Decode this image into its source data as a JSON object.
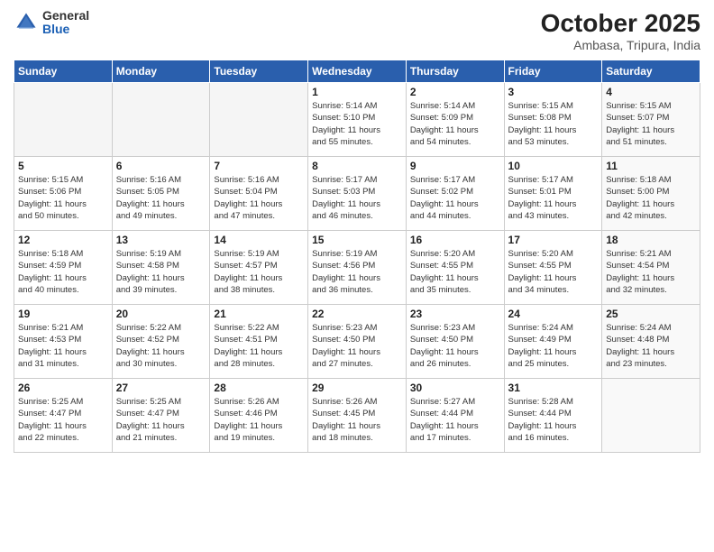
{
  "logo": {
    "general": "General",
    "blue": "Blue"
  },
  "header": {
    "month": "October 2025",
    "location": "Ambasa, Tripura, India"
  },
  "days_of_week": [
    "Sunday",
    "Monday",
    "Tuesday",
    "Wednesday",
    "Thursday",
    "Friday",
    "Saturday"
  ],
  "weeks": [
    [
      {
        "day": "",
        "info": ""
      },
      {
        "day": "",
        "info": ""
      },
      {
        "day": "",
        "info": ""
      },
      {
        "day": "1",
        "info": "Sunrise: 5:14 AM\nSunset: 5:10 PM\nDaylight: 11 hours\nand 55 minutes."
      },
      {
        "day": "2",
        "info": "Sunrise: 5:14 AM\nSunset: 5:09 PM\nDaylight: 11 hours\nand 54 minutes."
      },
      {
        "day": "3",
        "info": "Sunrise: 5:15 AM\nSunset: 5:08 PM\nDaylight: 11 hours\nand 53 minutes."
      },
      {
        "day": "4",
        "info": "Sunrise: 5:15 AM\nSunset: 5:07 PM\nDaylight: 11 hours\nand 51 minutes."
      }
    ],
    [
      {
        "day": "5",
        "info": "Sunrise: 5:15 AM\nSunset: 5:06 PM\nDaylight: 11 hours\nand 50 minutes."
      },
      {
        "day": "6",
        "info": "Sunrise: 5:16 AM\nSunset: 5:05 PM\nDaylight: 11 hours\nand 49 minutes."
      },
      {
        "day": "7",
        "info": "Sunrise: 5:16 AM\nSunset: 5:04 PM\nDaylight: 11 hours\nand 47 minutes."
      },
      {
        "day": "8",
        "info": "Sunrise: 5:17 AM\nSunset: 5:03 PM\nDaylight: 11 hours\nand 46 minutes."
      },
      {
        "day": "9",
        "info": "Sunrise: 5:17 AM\nSunset: 5:02 PM\nDaylight: 11 hours\nand 44 minutes."
      },
      {
        "day": "10",
        "info": "Sunrise: 5:17 AM\nSunset: 5:01 PM\nDaylight: 11 hours\nand 43 minutes."
      },
      {
        "day": "11",
        "info": "Sunrise: 5:18 AM\nSunset: 5:00 PM\nDaylight: 11 hours\nand 42 minutes."
      }
    ],
    [
      {
        "day": "12",
        "info": "Sunrise: 5:18 AM\nSunset: 4:59 PM\nDaylight: 11 hours\nand 40 minutes."
      },
      {
        "day": "13",
        "info": "Sunrise: 5:19 AM\nSunset: 4:58 PM\nDaylight: 11 hours\nand 39 minutes."
      },
      {
        "day": "14",
        "info": "Sunrise: 5:19 AM\nSunset: 4:57 PM\nDaylight: 11 hours\nand 38 minutes."
      },
      {
        "day": "15",
        "info": "Sunrise: 5:19 AM\nSunset: 4:56 PM\nDaylight: 11 hours\nand 36 minutes."
      },
      {
        "day": "16",
        "info": "Sunrise: 5:20 AM\nSunset: 4:55 PM\nDaylight: 11 hours\nand 35 minutes."
      },
      {
        "day": "17",
        "info": "Sunrise: 5:20 AM\nSunset: 4:55 PM\nDaylight: 11 hours\nand 34 minutes."
      },
      {
        "day": "18",
        "info": "Sunrise: 5:21 AM\nSunset: 4:54 PM\nDaylight: 11 hours\nand 32 minutes."
      }
    ],
    [
      {
        "day": "19",
        "info": "Sunrise: 5:21 AM\nSunset: 4:53 PM\nDaylight: 11 hours\nand 31 minutes."
      },
      {
        "day": "20",
        "info": "Sunrise: 5:22 AM\nSunset: 4:52 PM\nDaylight: 11 hours\nand 30 minutes."
      },
      {
        "day": "21",
        "info": "Sunrise: 5:22 AM\nSunset: 4:51 PM\nDaylight: 11 hours\nand 28 minutes."
      },
      {
        "day": "22",
        "info": "Sunrise: 5:23 AM\nSunset: 4:50 PM\nDaylight: 11 hours\nand 27 minutes."
      },
      {
        "day": "23",
        "info": "Sunrise: 5:23 AM\nSunset: 4:50 PM\nDaylight: 11 hours\nand 26 minutes."
      },
      {
        "day": "24",
        "info": "Sunrise: 5:24 AM\nSunset: 4:49 PM\nDaylight: 11 hours\nand 25 minutes."
      },
      {
        "day": "25",
        "info": "Sunrise: 5:24 AM\nSunset: 4:48 PM\nDaylight: 11 hours\nand 23 minutes."
      }
    ],
    [
      {
        "day": "26",
        "info": "Sunrise: 5:25 AM\nSunset: 4:47 PM\nDaylight: 11 hours\nand 22 minutes."
      },
      {
        "day": "27",
        "info": "Sunrise: 5:25 AM\nSunset: 4:47 PM\nDaylight: 11 hours\nand 21 minutes."
      },
      {
        "day": "28",
        "info": "Sunrise: 5:26 AM\nSunset: 4:46 PM\nDaylight: 11 hours\nand 19 minutes."
      },
      {
        "day": "29",
        "info": "Sunrise: 5:26 AM\nSunset: 4:45 PM\nDaylight: 11 hours\nand 18 minutes."
      },
      {
        "day": "30",
        "info": "Sunrise: 5:27 AM\nSunset: 4:44 PM\nDaylight: 11 hours\nand 17 minutes."
      },
      {
        "day": "31",
        "info": "Sunrise: 5:28 AM\nSunset: 4:44 PM\nDaylight: 11 hours\nand 16 minutes."
      },
      {
        "day": "",
        "info": ""
      }
    ]
  ]
}
